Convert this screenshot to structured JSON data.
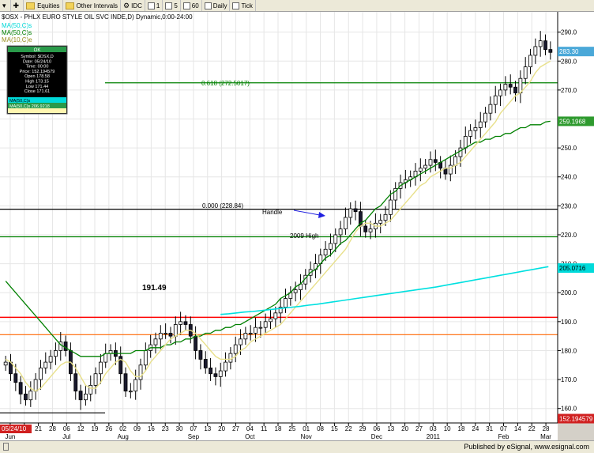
{
  "toolbar": {
    "items": [
      {
        "label": "Equities"
      },
      {
        "label": "Other Intervals"
      },
      {
        "label": "IDC"
      },
      {
        "label": "1"
      },
      {
        "label": "5"
      },
      {
        "label": "60"
      },
      {
        "label": "Daily"
      },
      {
        "label": "Tick"
      }
    ]
  },
  "chart": {
    "title": "$OSX - PHLX EURO STYLE OIL SVC INDE,D) Dynamic,0:00-24:00",
    "legend": {
      "ma50": "MA(50,C)s",
      "ma10": "MA(10,C)e"
    },
    "data_window": {
      "header": "OK",
      "rows": [
        "Symbol: $OSX,D",
        "Date: 05/24/10",
        "Time: 00:00",
        "Price: 152.194579",
        "Open 178.58",
        "High 173.15",
        "Low 171.44",
        "Close 171.61",
        "MA(50,C)s 206.9218"
      ]
    },
    "annotations": {
      "fib618": "0.618 (272.5017)",
      "fib0": "0.000 (228.84)",
      "handle": "Handle",
      "high2009": "2009 High",
      "level19149": "191.49"
    },
    "price_tags": {
      "current": "283.30",
      "ma50": "259.1968",
      "cursor": "152.194579",
      "cyan": "205.0716"
    },
    "cursor_date": "05/24/10",
    "footer_text": "Published by eSignal, www.esignal.com"
  },
  "chart_data": {
    "type": "candlestick",
    "title": "$OSX - PHLX EURO STYLE OIL SVC INDE,D) Dynamic,0:00-24:00",
    "ylim": [
      155,
      297
    ],
    "y_ticks": [
      160,
      170,
      180,
      190,
      200,
      210,
      220,
      230,
      240,
      250,
      260,
      270,
      280,
      290
    ],
    "x_day_labels": [
      "07",
      "14",
      "21",
      "28",
      "06",
      "12",
      "19",
      "26",
      "02",
      "09",
      "16",
      "23",
      "30",
      "07",
      "13",
      "20",
      "27",
      "04",
      "11",
      "18",
      "25",
      "01",
      "08",
      "15",
      "22",
      "29",
      "06",
      "13",
      "20",
      "27",
      "03",
      "10",
      "18",
      "24",
      "31",
      "07",
      "14",
      "22",
      "28"
    ],
    "x_month_labels": [
      "Jun",
      "Jul",
      "Aug",
      "Sep",
      "Oct",
      "Nov",
      "Dec",
      "2011",
      "Feb",
      "Mar"
    ],
    "horizontal_lines": [
      {
        "name": "0.618 (272.5017)",
        "value": 272.5,
        "color": "#008000"
      },
      {
        "name": "0.000 (228.84)",
        "value": 228.84,
        "color": "#000000"
      },
      {
        "name": "2009 High",
        "value": 219.3,
        "color": "#008000"
      },
      {
        "name": "191.49",
        "value": 191.49,
        "color": "#ff0000"
      },
      {
        "name": "orange",
        "value": 185.5,
        "color": "#ff6600"
      },
      {
        "name": "base",
        "value": 158.5,
        "color": "#000000"
      }
    ],
    "close": [
      176,
      172,
      169,
      165,
      163,
      166,
      170,
      174,
      176,
      178,
      180,
      183,
      180,
      172,
      166,
      163,
      165,
      168,
      172,
      176,
      179,
      180,
      178,
      172,
      166,
      166,
      170,
      175,
      180,
      182,
      184,
      186,
      186,
      185,
      189,
      190,
      189,
      185,
      180,
      177,
      174,
      172,
      171,
      173,
      176,
      179,
      182,
      184,
      186,
      186,
      188,
      188,
      190,
      191,
      193,
      195,
      198,
      200,
      201,
      203,
      206,
      208,
      210,
      213,
      215,
      217,
      220,
      222,
      226,
      229,
      228,
      223,
      221,
      222,
      224,
      225,
      227,
      232,
      236,
      238,
      239,
      240,
      242,
      243,
      244,
      246,
      245,
      243,
      241,
      244,
      247,
      250,
      254,
      256,
      257,
      259,
      262,
      265,
      268,
      270,
      272,
      271,
      269,
      274,
      278,
      282,
      285,
      287,
      284,
      283
    ],
    "ma50": [
      204,
      202,
      200,
      198,
      196,
      194,
      192,
      190,
      188,
      186,
      184,
      182,
      181,
      180,
      179,
      178,
      178,
      178,
      178,
      178,
      179,
      179,
      179,
      179,
      179,
      179,
      180,
      180,
      180,
      181,
      181,
      181,
      182,
      182,
      183,
      183,
      184,
      184,
      185,
      185,
      186,
      186,
      187,
      187,
      188,
      188,
      189,
      189,
      190,
      191,
      192,
      193,
      194,
      195,
      196,
      198,
      199,
      200,
      202,
      203,
      205,
      207,
      208,
      210,
      212,
      213,
      215,
      217,
      218,
      220,
      222,
      224,
      225,
      227,
      229,
      230,
      232,
      234,
      235,
      237,
      238,
      239,
      240,
      241,
      242,
      243,
      244,
      245,
      246,
      247,
      248,
      249,
      250,
      251,
      252,
      252,
      253,
      253,
      254,
      254,
      255,
      255,
      256,
      257,
      257,
      258,
      258,
      258,
      259,
      259.2
    ],
    "ma10": [
      177,
      176,
      174,
      172,
      169,
      167,
      166,
      167,
      169,
      171,
      173,
      175,
      176,
      176,
      174,
      171,
      168,
      167,
      167,
      169,
      172,
      174,
      176,
      177,
      176,
      173,
      171,
      171,
      173,
      176,
      178,
      180,
      182,
      184,
      185,
      186,
      187,
      187,
      186,
      184,
      182,
      180,
      178,
      177,
      177,
      177,
      178,
      180,
      181,
      183,
      184,
      185,
      186,
      187,
      188,
      189,
      191,
      193,
      195,
      197,
      199,
      201,
      203,
      205,
      207,
      209,
      211,
      213,
      215,
      218,
      221,
      223,
      224,
      224,
      223,
      223,
      224,
      225,
      227,
      229,
      231,
      233,
      235,
      237,
      238,
      240,
      241,
      242,
      243,
      243,
      244,
      245,
      247,
      249,
      251,
      253,
      255,
      257,
      259,
      262,
      264,
      266,
      268,
      269,
      271,
      273,
      276,
      278,
      279,
      280
    ],
    "cyan_ma": {
      "start_index": 43,
      "values": [
        192.5,
        192.7,
        193,
        193.3,
        193.5,
        193.8,
        194.1,
        194.4,
        194.7,
        195,
        195.3,
        195.7,
        196,
        196.4,
        196.8,
        197.2,
        197.6,
        198,
        198.4,
        198.8,
        199.2,
        199.6,
        200,
        200.4,
        200.8,
        201.2,
        201.6,
        202,
        202.5,
        203,
        203.5,
        204,
        204.5,
        205,
        205.5,
        206,
        206.5,
        207,
        207.5,
        208,
        208.5,
        209
      ]
    }
  }
}
